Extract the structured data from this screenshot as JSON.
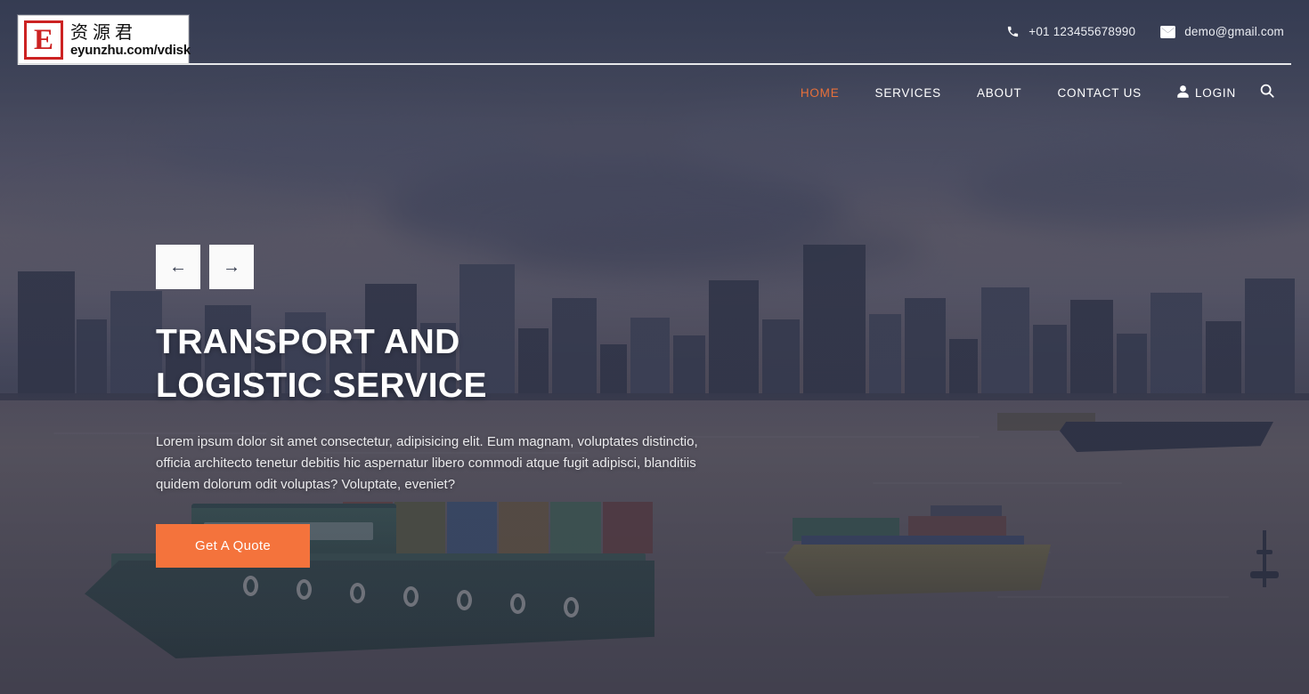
{
  "site": {
    "logo": {
      "mark_letter": "E",
      "chinese_name": "资源君",
      "url_text": "eyunzhu.com/vdisk"
    }
  },
  "topbar": {
    "phone_icon": "phone-icon",
    "phone": "+01 123455678990",
    "email_icon": "envelope-icon",
    "email": "demo@gmail.com"
  },
  "nav": {
    "items": [
      {
        "label": "HOME",
        "active": true
      },
      {
        "label": "SERVICES",
        "active": false
      },
      {
        "label": "ABOUT",
        "active": false
      },
      {
        "label": "CONTACT US",
        "active": false
      }
    ],
    "login_label": "LOGIN",
    "login_icon": "user-icon",
    "search_icon": "search-icon",
    "active_color": "#e8703a"
  },
  "hero": {
    "prev_arrow": "←",
    "next_arrow": "→",
    "title_line1": "TRANSPORT AND",
    "title_line2": "LOGISTIC SERVICE",
    "description": "Lorem ipsum dolor sit amet consectetur, adipisicing elit. Eum magnam, voluptates distinctio, officia architecto tenetur debitis hic aspernatur libero commodi atque fugit adipisci, blanditiis quidem dolorum odit voluptas? Voluptate, eveniet?",
    "cta_label": "Get A Quote",
    "cta_color": "#f4733c",
    "background_scene": "river city skyline at dusk with cargo barges"
  }
}
